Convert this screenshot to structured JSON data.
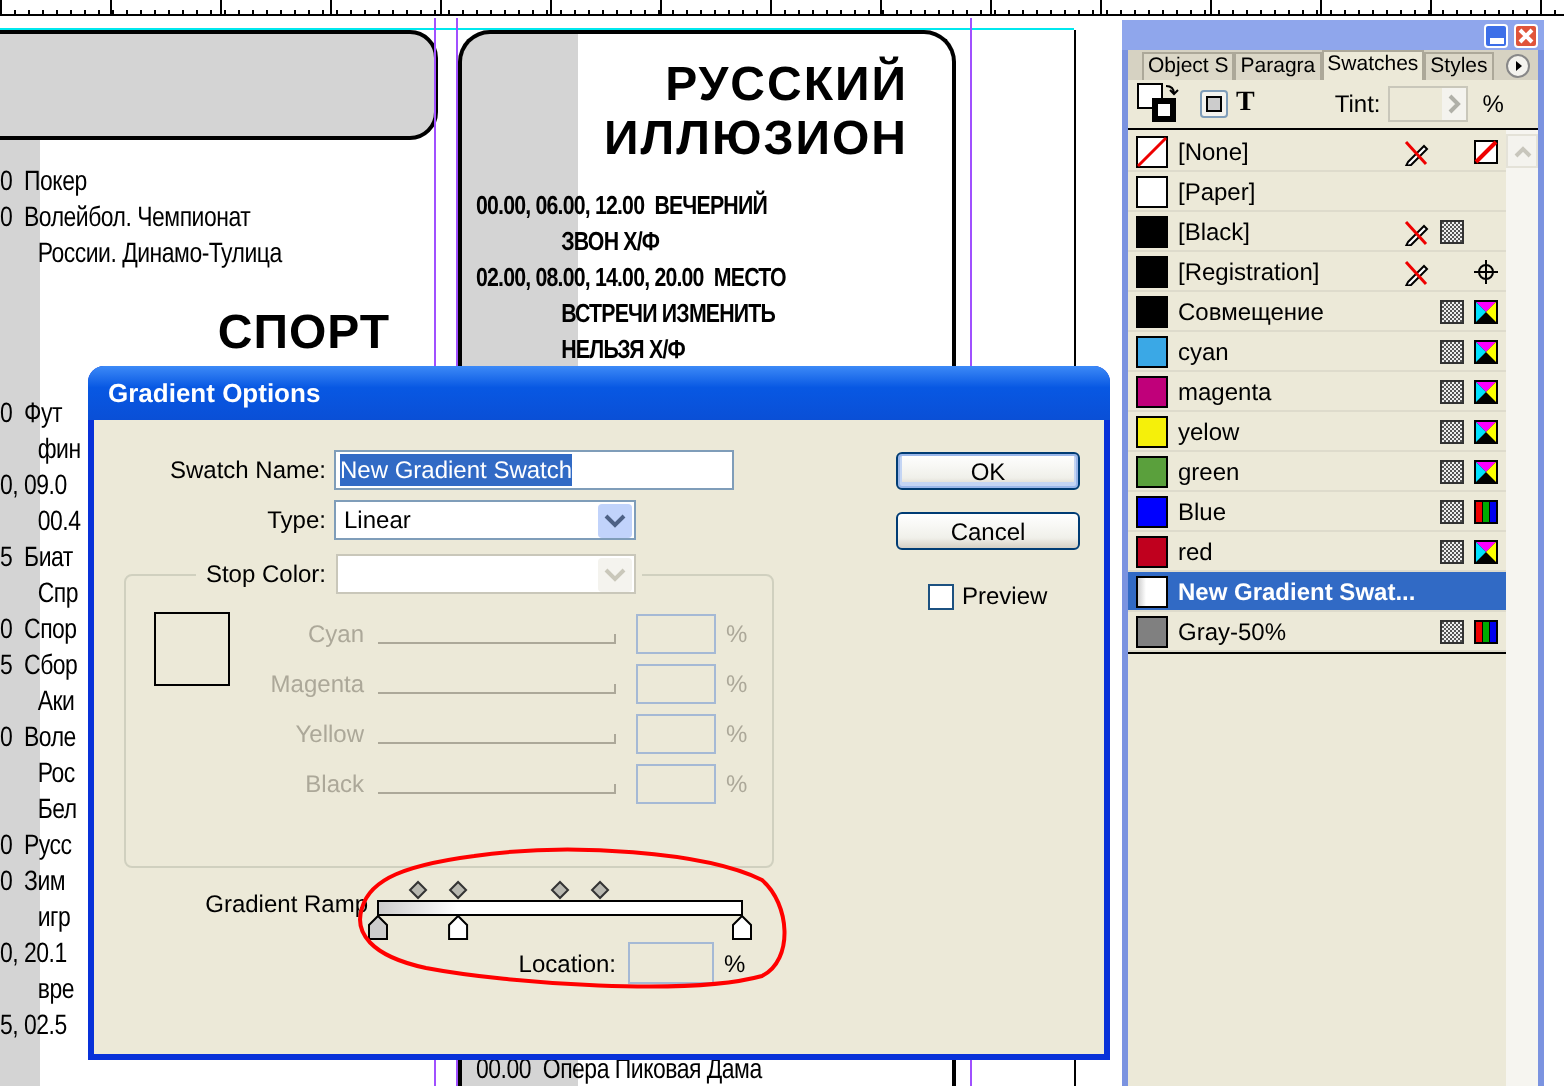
{
  "document": {
    "left_column": {
      "lines_top": [
        {
          "text": "0  Покер",
          "kind": "entry"
        },
        {
          "text": "0  Волейбол. Чемпионат",
          "kind": "entry"
        },
        {
          "text": "России. Динамо-Тулица",
          "kind": "continuation"
        }
      ],
      "heading": "СПОРТ",
      "lines_bottom": [
        {
          "text": "0  Фут",
          "kind": "entry"
        },
        {
          "text": "фин",
          "kind": "continuation"
        },
        {
          "text": "0, 09.0",
          "kind": "entry"
        },
        {
          "text": "00.4",
          "kind": "continuation"
        },
        {
          "text": "5  Биат",
          "kind": "entry"
        },
        {
          "text": "Спр",
          "kind": "continuation"
        },
        {
          "text": "0  Спор",
          "kind": "entry"
        },
        {
          "text": "5  Сбор",
          "kind": "entry"
        },
        {
          "text": "Аки",
          "kind": "continuation"
        },
        {
          "text": "0  Воле",
          "kind": "entry"
        },
        {
          "text": "Рос",
          "kind": "continuation"
        },
        {
          "text": "Бел",
          "kind": "continuation"
        },
        {
          "text": "0  Русс",
          "kind": "entry"
        },
        {
          "text": "0  Зим",
          "kind": "entry"
        },
        {
          "text": "игр",
          "kind": "continuation"
        },
        {
          "text": "0, 20.1",
          "kind": "entry"
        },
        {
          "text": "вре",
          "kind": "continuation"
        },
        {
          "text": "5, 02.5",
          "kind": "entry"
        }
      ]
    },
    "right_column": {
      "heading": "РУССКИЙ ИЛЛЮЗИОН",
      "lines_top": [
        {
          "text": "00.00, 06.00, 12.00  ВЕЧЕРНИЙ",
          "kind": "entry"
        },
        {
          "text": "ЗВОН Х/Ф",
          "kind": "continuation"
        },
        {
          "text": "02.00, 08.00, 14.00, 20.00  МЕСТО",
          "kind": "entry"
        },
        {
          "text": "ВСТРЕЧИ ИЗМЕНИТЬ",
          "kind": "continuation"
        },
        {
          "text": "НЕЛЬЗЯ Х/Ф",
          "kind": "continuation"
        }
      ],
      "lines_bottom": [
        {
          "text": "00.00  Опера Пиковая Дама",
          "kind": "entry"
        }
      ]
    }
  },
  "dialog": {
    "title": "Gradient Options",
    "swatch_name": {
      "label": "Swatch Name:",
      "value": "New Gradient Swatch",
      "text_selected": true
    },
    "type": {
      "label": "Type:",
      "value": "Linear",
      "disabled": false
    },
    "stop_color": {
      "label": "Stop Color:",
      "disabled": true
    },
    "color_sliders": [
      {
        "label": "Cyan",
        "unit": "%",
        "disabled": true
      },
      {
        "label": "Magenta",
        "unit": "%",
        "disabled": true
      },
      {
        "label": "Yellow",
        "unit": "%",
        "disabled": true
      },
      {
        "label": "Black",
        "unit": "%",
        "disabled": true
      }
    ],
    "gradient_ramp": {
      "label": "Gradient Ramp",
      "stops": [
        {
          "level": 0,
          "color": "#cccccc"
        },
        {
          "level": 0.22,
          "color": "#ffffff"
        },
        {
          "level": 1,
          "color": "#ffffff"
        }
      ],
      "midpoints": [
        {
          "level": 0.11
        },
        {
          "level": 0.22
        },
        {
          "level": 0.5
        },
        {
          "level": 0.61
        }
      ]
    },
    "location": {
      "label": "Location:",
      "unit": "%"
    },
    "buttons": [
      {
        "label": "OK",
        "default": true
      },
      {
        "label": "Cancel",
        "default": false
      }
    ],
    "preview": {
      "label": "Preview",
      "checked": false
    }
  },
  "swatches_panel": {
    "tabs": [
      {
        "label": "Object S",
        "selected": false
      },
      {
        "label": "Paragra",
        "selected": false
      },
      {
        "label": "Swatches",
        "selected": true
      },
      {
        "label": "Styles",
        "selected": false
      }
    ],
    "text_glyph": "T",
    "tint": {
      "label": "Tint:",
      "unit": "%",
      "disabled": true
    },
    "swatches": [
      {
        "name": "[None]",
        "kind": "none",
        "selected": false,
        "locked": true,
        "process": false
      },
      {
        "name": "[Paper]",
        "kind": "plain",
        "color": "#ffffff",
        "selected": false,
        "locked": false,
        "process": false
      },
      {
        "name": "[Black]",
        "kind": "plain",
        "color": "#000000",
        "selected": false,
        "locked": true,
        "process": true
      },
      {
        "name": "[Registration]",
        "kind": "registration",
        "color": "#000000",
        "selected": false,
        "locked": true,
        "process": false
      },
      {
        "name": "Совмещение",
        "kind": "cmyk",
        "color": "#000000",
        "selected": false,
        "locked": false,
        "process": true
      },
      {
        "name": "cyan",
        "kind": "cmyk",
        "color": "#3aa8e6",
        "selected": false,
        "locked": false,
        "process": true
      },
      {
        "name": "magenta",
        "kind": "cmyk",
        "color": "#c0007a",
        "selected": false,
        "locked": false,
        "process": true
      },
      {
        "name": "yelow",
        "kind": "cmyk",
        "color": "#f5f00a",
        "selected": false,
        "locked": false,
        "process": true
      },
      {
        "name": "green",
        "kind": "cmyk",
        "color": "#5aa03c",
        "selected": false,
        "locked": false,
        "process": true
      },
      {
        "name": "Blue",
        "kind": "rgb",
        "color": "#0000ff",
        "selected": false,
        "locked": false,
        "process": true
      },
      {
        "name": "red",
        "kind": "cmyk",
        "color": "#c0001e",
        "selected": false,
        "locked": false,
        "process": true
      },
      {
        "name": "New Gradient Swat...",
        "kind": "gradient",
        "selected": true,
        "locked": false,
        "process": false
      },
      {
        "name": "Gray-50%",
        "kind": "rgb",
        "color": "#808080",
        "selected": false,
        "locked": false,
        "process": true
      }
    ]
  }
}
